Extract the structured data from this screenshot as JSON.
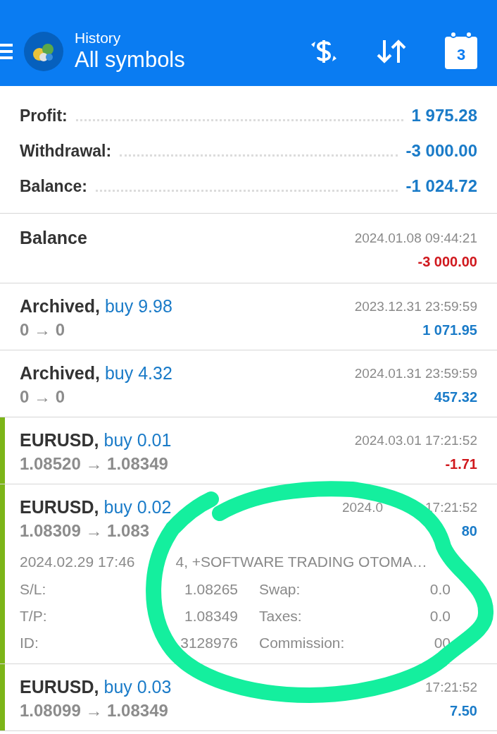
{
  "header": {
    "subtitle": "History",
    "title": "All symbols",
    "calendar_day": "3"
  },
  "summary": [
    {
      "label": "Profit:",
      "value": "1 975.28"
    },
    {
      "label": "Withdrawal:",
      "value": "-3 000.00"
    },
    {
      "label": "Balance:",
      "value": "-1 024.72"
    }
  ],
  "deals": [
    {
      "kind": "balance",
      "symbol": "Balance",
      "time_parts": [
        "2024.01.08 09:44:21"
      ],
      "profit": "-3 000.00",
      "negative": true,
      "marked": false
    },
    {
      "kind": "trade",
      "symbol": "Archived,",
      "action": "buy 9.98",
      "time_parts": [
        "2023.12.31 23:59:59"
      ],
      "prices": "0 → 0",
      "profit": "1 071.95",
      "negative": false,
      "marked": false
    },
    {
      "kind": "trade",
      "symbol": "Archived,",
      "action": "buy 4.32",
      "time_parts": [
        "2024.01.31 23:59:59"
      ],
      "prices": "0 → 0",
      "profit": "457.32",
      "negative": false,
      "marked": false
    },
    {
      "kind": "trade",
      "symbol": "EURUSD,",
      "action": "buy 0.01",
      "time_parts": [
        "2024.03.01 17:21:52"
      ],
      "prices": "1.08520 → 1.08349",
      "profit": "-1.71",
      "negative": true,
      "marked": true
    },
    {
      "kind": "trade",
      "symbol": "EURUSD,",
      "action": "buy 0.02",
      "time_parts": [
        "2024.0",
        "17:21:52"
      ],
      "prices": "1.08309 → 1.083",
      "profit": "80",
      "negative": false,
      "marked": true,
      "comment_parts": [
        "2024.02.29 17:46",
        "4, +SOFTWARE TRADING OTOMA…"
      ],
      "details": [
        {
          "label": "S/L:",
          "value": "1.08265",
          "label2": "Swap:",
          "value2": "0.0"
        },
        {
          "label": "T/P:",
          "value": "1.08349",
          "label2": "Taxes:",
          "value2": "0.0"
        },
        {
          "label": "ID:",
          "value": "3128976",
          "label2": "Commission:",
          "value2": "00"
        }
      ]
    },
    {
      "kind": "trade",
      "symbol": "EURUSD,",
      "action": "buy 0.03",
      "time_parts": [
        "17:21:52"
      ],
      "prices": "1.08099 → 1.08349",
      "profit": "7.50",
      "negative": false,
      "marked": true
    }
  ],
  "annotation": {
    "kind": "scribble",
    "color": "#14ef9e"
  }
}
